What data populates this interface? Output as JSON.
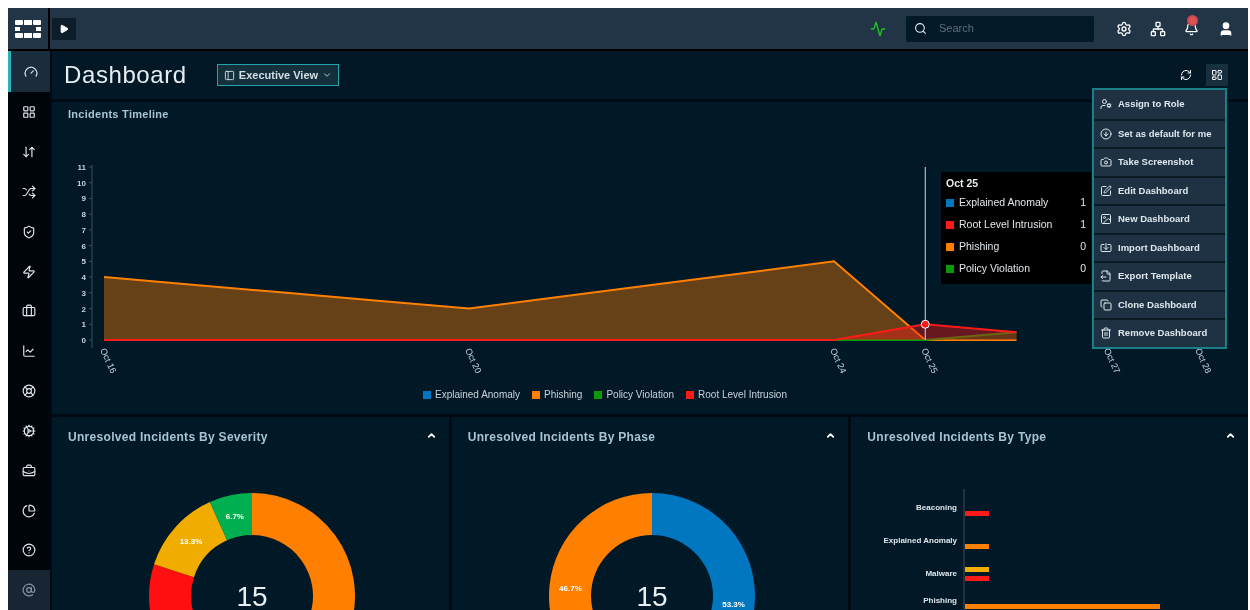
{
  "topbar": {
    "search": {
      "placeholder": "Search"
    }
  },
  "sidebar": {
    "items": [
      {
        "selected": true
      },
      {
        "selected": false
      },
      {
        "selected": false
      },
      {
        "selected": false
      },
      {
        "selected": false
      },
      {
        "selected": false
      },
      {
        "selected": false
      },
      {
        "selected": false
      },
      {
        "selected": false
      },
      {
        "selected": false
      },
      {
        "selected": false
      },
      {
        "selected": false
      },
      {
        "selected": false
      },
      {
        "selected": false
      }
    ]
  },
  "header": {
    "title": "Dashboard",
    "view_button": "Executive View"
  },
  "menu": {
    "items": [
      "Assign to Role",
      "Set as default for me",
      "Take Screenshot",
      "Edit Dashboard",
      "New Dashboard",
      "Import Dashboard",
      "Export Template",
      "Clone Dashboard",
      "Remove Dashboard"
    ]
  },
  "timeline": {
    "title": "Incidents Timeline",
    "chart_data": {
      "type": "area",
      "categories": [
        "Oct 16",
        null,
        null,
        null,
        "Oct 20",
        null,
        null,
        null,
        "Oct 24",
        "Oct 25",
        null,
        "Oct 27",
        "Oct 28"
      ],
      "ylim": [
        0,
        11
      ],
      "yticks": [
        0,
        1,
        2,
        3,
        4,
        5,
        6,
        7,
        8,
        9,
        10,
        11
      ],
      "series": [
        {
          "name": "Explained Anomaly",
          "color": "#0077c0",
          "values": [
            null,
            null,
            null,
            null,
            null,
            null,
            null,
            null,
            null,
            null,
            null,
            null,
            null
          ]
        },
        {
          "name": "Phishing",
          "color": "#ff8000",
          "values": [
            4,
            3.5,
            3,
            2.5,
            2,
            2.75,
            3.5,
            4.25,
            5,
            0,
            0,
            null,
            null
          ]
        },
        {
          "name": "Policy Violation",
          "color": "#0a9a0a",
          "values": [
            0,
            0,
            0,
            0,
            0,
            0,
            0,
            0,
            0,
            0,
            0.5,
            null,
            null
          ]
        },
        {
          "name": "Root Level Intrusion",
          "color": "#ff1a1a",
          "values": [
            0,
            0,
            0,
            0,
            0,
            0,
            0,
            0,
            0,
            1,
            0.5,
            null,
            null
          ]
        }
      ]
    },
    "tooltip": {
      "title": "Oct 25",
      "rows": [
        {
          "name": "Explained Anomaly",
          "color": "#0077c0",
          "value": "1"
        },
        {
          "name": "Root Level Intrusion",
          "color": "#ff1a1a",
          "value": "1"
        },
        {
          "name": "Phishing",
          "color": "#ff8000",
          "value": "0"
        },
        {
          "name": "Policy Violation",
          "color": "#0a9a0a",
          "value": "0"
        }
      ]
    }
  },
  "panels": [
    {
      "kind": "donut",
      "title": "Unresolved Incidents By Severity",
      "total": "15",
      "chart_data": {
        "type": "donut",
        "values": [
          60,
          20,
          13.3,
          6.7
        ],
        "colors": [
          "#ff8000",
          "#ff0f0f",
          "#f0ad00",
          "#00b050"
        ],
        "value_labels": [
          null,
          null,
          "13.3%",
          "6.7%"
        ]
      }
    },
    {
      "kind": "donut",
      "title": "Unresolved Incidents By Phase",
      "total": "15",
      "chart_data": {
        "type": "donut",
        "values": [
          53.3,
          46.7
        ],
        "colors": [
          "#0077c0",
          "#ff8000"
        ],
        "value_labels": [
          "53.3%",
          "46.7%"
        ]
      }
    },
    {
      "kind": "bars",
      "title": "Unresolved Incidents By Type",
      "categories": [
        {
          "label": "Beaconing",
          "bars": [
            {
              "color": "#ff1a1a"
            }
          ]
        },
        {
          "label": "Explained Anomaly",
          "bars": [
            {
              "color": "#ff8000"
            }
          ]
        },
        {
          "label": "Malware",
          "bars": [
            {
              "color": "#f0ad00"
            },
            {
              "color": "#ff1a1a"
            }
          ]
        },
        {
          "label": "Phishing",
          "bars": [
            {
              "color": "#ff8000"
            }
          ]
        }
      ]
    }
  ]
}
